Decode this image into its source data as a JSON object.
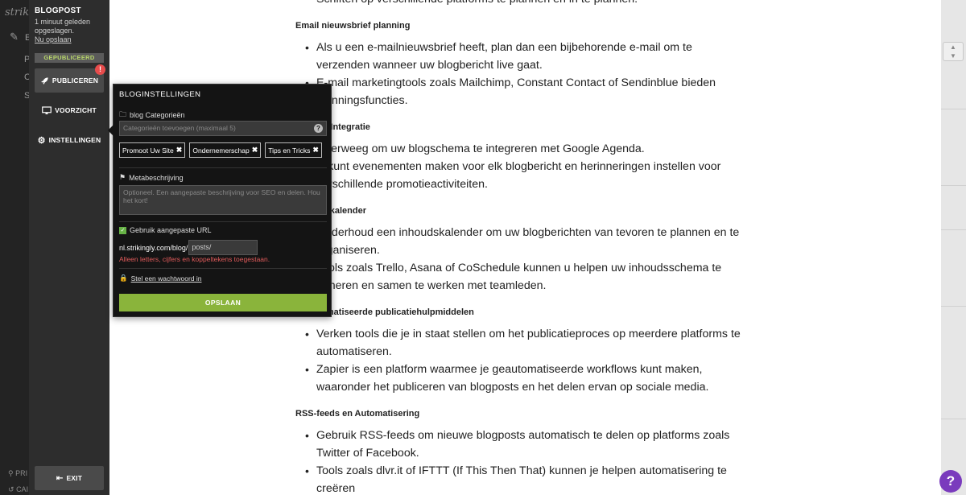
{
  "rail": {
    "logo": "strik",
    "letters": [
      "E",
      "P",
      "C",
      "S"
    ],
    "bottom_items": [
      "PRI",
      "CAI"
    ]
  },
  "panel": {
    "title": "BLOGPOST",
    "saved_text": "1 minuut geleden opgeslagen.",
    "save_now_link": "Nu opslaan",
    "status_badge": "GEPUBLICEERD",
    "publish_label": "PUBLICEREN",
    "alert_mark": "!",
    "preview_label": "VOORZICHT",
    "settings_label": "INSTELLINGEN",
    "exit_label": "EXIT"
  },
  "settings_popover": {
    "title": "BLOGINSTELLINGEN",
    "categories_label": "blog Categorieën",
    "categories_placeholder": "Categorieën toevoegen (maximaal 5)",
    "help_mark": "?",
    "tags": [
      "Promoot Uw Site",
      "Ondernemerschap",
      "Tips en Tricks"
    ],
    "meta_label": "Metabeschrijving",
    "meta_placeholder": "Optioneel. Een aangepaste beschrijving voor SEO en delen. Hou het kort!",
    "custom_url_label": "Gebruik aangepaste URL",
    "url_prefix": "nl.strikingly.com/blog/",
    "url_slug": "posts/",
    "url_error": "Alleen letters, cijfers en koppeltekens toegestaan.",
    "password_link": "Stel een wachtwoord in",
    "save_label": "OPSLAAN"
  },
  "article": {
    "top_fragment": "Schiften op verschillende platforms te plannen en in te plannen.",
    "sections": [
      {
        "heading": "Email nieuwsbrief planning",
        "items": [
          "Als u een e-mailnieuwsbrief heeft, plan dan een bijbehorende e-mail om te verzenden wanneer uw blogbericht live gaat.",
          "E-mail marketingtools zoals Mailchimp, Constant Contact of Sendinblue bieden planningsfuncties."
        ]
      },
      {
        "heading": "Agenda Integratie",
        "items": [
          "Overweeg om uw blogschema te integreren met Google Agenda.",
          "U kunt evenementen maken voor elk blogbericht en herinneringen instellen voor verschillende promotieactiviteiten."
        ]
      },
      {
        "heading": "Inhoudskalender",
        "items": [
          "Onderhoud een inhoudskalender om uw blogberichten van tevoren te plannen en te organiseren.",
          "Tools zoals Trello, Asana of CoSchedule kunnen u helpen uw inhoudsschema te beheren en samen te werken met teamleden."
        ]
      },
      {
        "heading": "Geautomatiseerde publicatiehulpmiddelen",
        "items": [
          "Verken tools die je in staat stellen om het publicatieproces op meerdere platforms te automatiseren.",
          "Zapier is een platform waarmee je geautomatiseerde workflows kunt maken, waaronder het publiceren van blogposts en het delen ervan op sociale media."
        ]
      },
      {
        "heading": "RSS-feeds en Automatisering",
        "items": [
          "Gebruik RSS-feeds om nieuwe blogposts automatisch te delen op platforms zoals Twitter of Facebook.",
          "Tools zoals dlvr.it of IFTTT (If This Then That) kunnen je helpen automatisering te creëren"
        ]
      }
    ]
  },
  "help_bubble": "?",
  "colors": {
    "accent_green": "#8ab43b",
    "status_green": "#b8d66a",
    "error_red": "#e25b5b",
    "help_purple": "#7a3bbd"
  }
}
